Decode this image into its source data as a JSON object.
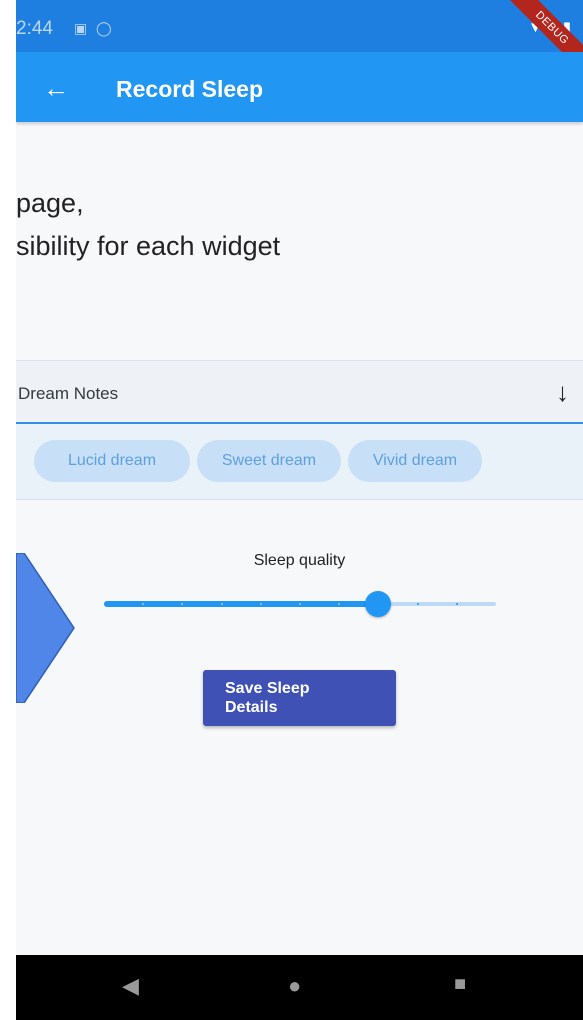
{
  "status_bar": {
    "time": "2:44",
    "icons": [
      "notification-icon",
      "shield-icon"
    ],
    "right_icons": [
      "wifi-icon",
      "signal-icon",
      "battery-icon"
    ],
    "debug_banner": "DEBUG"
  },
  "app_bar": {
    "back_icon": "arrow-back-icon",
    "title": "Record Sleep"
  },
  "overlay": {
    "line1": "page,",
    "line2": "sibility for each widget"
  },
  "dream_notes": {
    "label": "Dream Notes",
    "icon": "arrow-down-icon"
  },
  "chips": [
    {
      "label": "Lucid dream"
    },
    {
      "label": "Sweet dream"
    },
    {
      "label": "Vivid dream"
    }
  ],
  "slider": {
    "label": "Sleep quality",
    "divisions": 10,
    "value": 7
  },
  "save_button": {
    "label": "Save Sleep\nDetails"
  },
  "nav_bar": {
    "back_icon": "nav-back-icon",
    "home_icon": "nav-home-icon",
    "recents_icon": "nav-recents-icon"
  },
  "colors": {
    "app_bar": "#2196f3",
    "status_bar": "#1e7fe0",
    "button": "#3f51b5",
    "accent": "#2196f3",
    "overlay_arrow": "#4f86e8"
  }
}
